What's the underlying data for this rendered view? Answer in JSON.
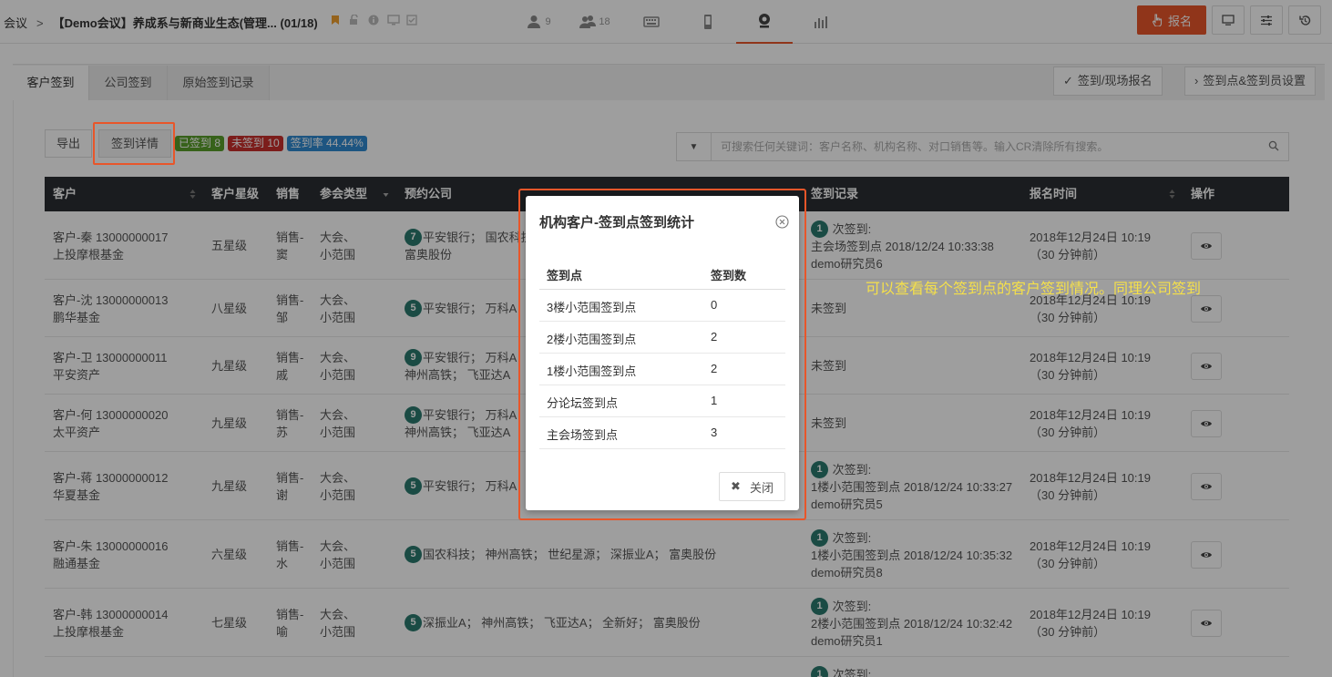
{
  "header": {
    "crumb_root": "会议",
    "crumb_sep": ">",
    "meeting_title": "【Demo会议】养成系与新商业生态(管理... (01/18)",
    "nav": [
      {
        "icon": "person-icon",
        "count": "9"
      },
      {
        "icon": "group-icon",
        "count": "18"
      },
      {
        "icon": "keyboard-icon",
        "count": ""
      },
      {
        "icon": "phone-icon",
        "count": ""
      },
      {
        "icon": "webcam-icon",
        "count": ""
      },
      {
        "icon": "bar-chart-icon",
        "count": ""
      }
    ],
    "signup_label": "报名",
    "accent": "#e8562a"
  },
  "tabs": [
    "客户签到",
    "公司签到",
    "原始签到记录"
  ],
  "right_buttons": {
    "checkin": "签到/现场报名",
    "settings": "签到点&签到员设置"
  },
  "toolbar": {
    "export": "导出",
    "detail": "签到详情",
    "badge_signed": "已签到 8",
    "badge_unsigned": "未签到 10",
    "badge_rate": "签到率 44.44%",
    "search_placeholder": "可搜索任何关键词：客户名称、机构名称、对口销售等。输入CR清除所有搜索。"
  },
  "table": {
    "headers": {
      "customer": "客户",
      "star": "客户星级",
      "sales": "销售",
      "type": "参会类型",
      "company": "预约公司",
      "record": "签到记录",
      "time": "报名时间",
      "ops": "操作"
    },
    "rows": [
      {
        "name": "客户-秦 13000000017",
        "org": "上投摩根基金",
        "star": "五星级",
        "sales1": "销售-",
        "sales2": "窦",
        "type1": "大会、",
        "type2": "小范围",
        "cnum": "7",
        "co1": "平安银行；  国农科技",
        "co2": "富奥股份",
        "rnum": "1",
        "r1": " 次签到:",
        "r2": "主会场签到点 2018/12/24 10:33:38",
        "r3": "demo研究员6",
        "t1": "2018年12月24日 10:19",
        "t2": "（30 分钟前）"
      },
      {
        "name": "客户-沈 13000000013",
        "org": "鹏华基金",
        "star": "八星级",
        "sales1": "销售-",
        "sales2": "邹",
        "type1": "大会、",
        "type2": "小范围",
        "cnum": "5",
        "co1": "平安银行；  万科A",
        "co2": "",
        "rnum": "",
        "r1": "未签到",
        "r2": "",
        "r3": "",
        "t1": "2018年12月24日 10:19",
        "t2": "（30 分钟前）"
      },
      {
        "name": "客户-卫 13000000011",
        "org": "平安资产",
        "star": "九星级",
        "sales1": "销售-",
        "sales2": "戚",
        "type1": "大会、",
        "type2": "小范围",
        "cnum": "9",
        "co1": "平安银行；  万科A",
        "co2": "神州高铁；  飞亚达A",
        "rnum": "",
        "r1": "未签到",
        "r2": "",
        "r3": "",
        "t1": "2018年12月24日 10:19",
        "t2": "（30 分钟前）"
      },
      {
        "name": "客户-何 13000000020",
        "org": "太平资产",
        "star": "九星级",
        "sales1": "销售-",
        "sales2": "苏",
        "type1": "大会、",
        "type2": "小范围",
        "cnum": "9",
        "co1": "平安银行；  万科A",
        "co2": "神州高铁；  飞亚达A",
        "rnum": "",
        "r1": "未签到",
        "r2": "",
        "r3": "",
        "t1": "2018年12月24日 10:19",
        "t2": "（30 分钟前）"
      },
      {
        "name": "客户-蒋 13000000012",
        "org": "华夏基金",
        "star": "九星级",
        "sales1": "销售-",
        "sales2": "谢",
        "type1": "大会、",
        "type2": "小范围",
        "cnum": "5",
        "co1": "平安银行；  万科A",
        "co2": "",
        "rnum": "1",
        "r1": " 次签到:",
        "r2": "1楼小范围签到点 2018/12/24 10:33:27",
        "r3": "demo研究员5",
        "t1": "2018年12月24日 10:19",
        "t2": "（30 分钟前）"
      },
      {
        "name": "客户-朱 13000000016",
        "org": "融通基金",
        "star": "六星级",
        "sales1": "销售-",
        "sales2": "水",
        "type1": "大会、",
        "type2": "小范围",
        "cnum": "5",
        "co1": "国农科技；  神州高铁；  世纪星源；  深振业A；  富奥股份",
        "co2": "",
        "rnum": "1",
        "r1": " 次签到:",
        "r2": "1楼小范围签到点 2018/12/24 10:35:32",
        "r3": "demo研究员8",
        "t1": "2018年12月24日 10:19",
        "t2": "（30 分钟前）"
      },
      {
        "name": "客户-韩 13000000014",
        "org": "上投摩根基金",
        "star": "七星级",
        "sales1": "销售-",
        "sales2": "喻",
        "type1": "大会、",
        "type2": "小范围",
        "cnum": "5",
        "co1": "深振业A；  神州高铁；  飞亚达A；  全新好；  富奥股份",
        "co2": "",
        "rnum": "1",
        "r1": " 次签到:",
        "r2": "2楼小范围签到点 2018/12/24 10:32:42",
        "r3": "demo研究员1",
        "t1": "2018年12月24日 10:19",
        "t2": "（30 分钟前）"
      }
    ],
    "last_row_num": "1",
    "last_row_text": " 次签到:"
  },
  "modal": {
    "title": "机构客户-签到点签到统计",
    "col_point": "签到点",
    "col_count": "签到数",
    "rows": [
      {
        "point": "3楼小范围签到点",
        "count": "0"
      },
      {
        "point": "2楼小范围签到点",
        "count": "2"
      },
      {
        "point": "1楼小范围签到点",
        "count": "2"
      },
      {
        "point": "分论坛签到点",
        "count": "1"
      },
      {
        "point": "主会场签到点",
        "count": "3"
      }
    ],
    "close_label": "关闭"
  },
  "annotation": "可以查看每个签到点的客户签到情况。同理公司签到"
}
